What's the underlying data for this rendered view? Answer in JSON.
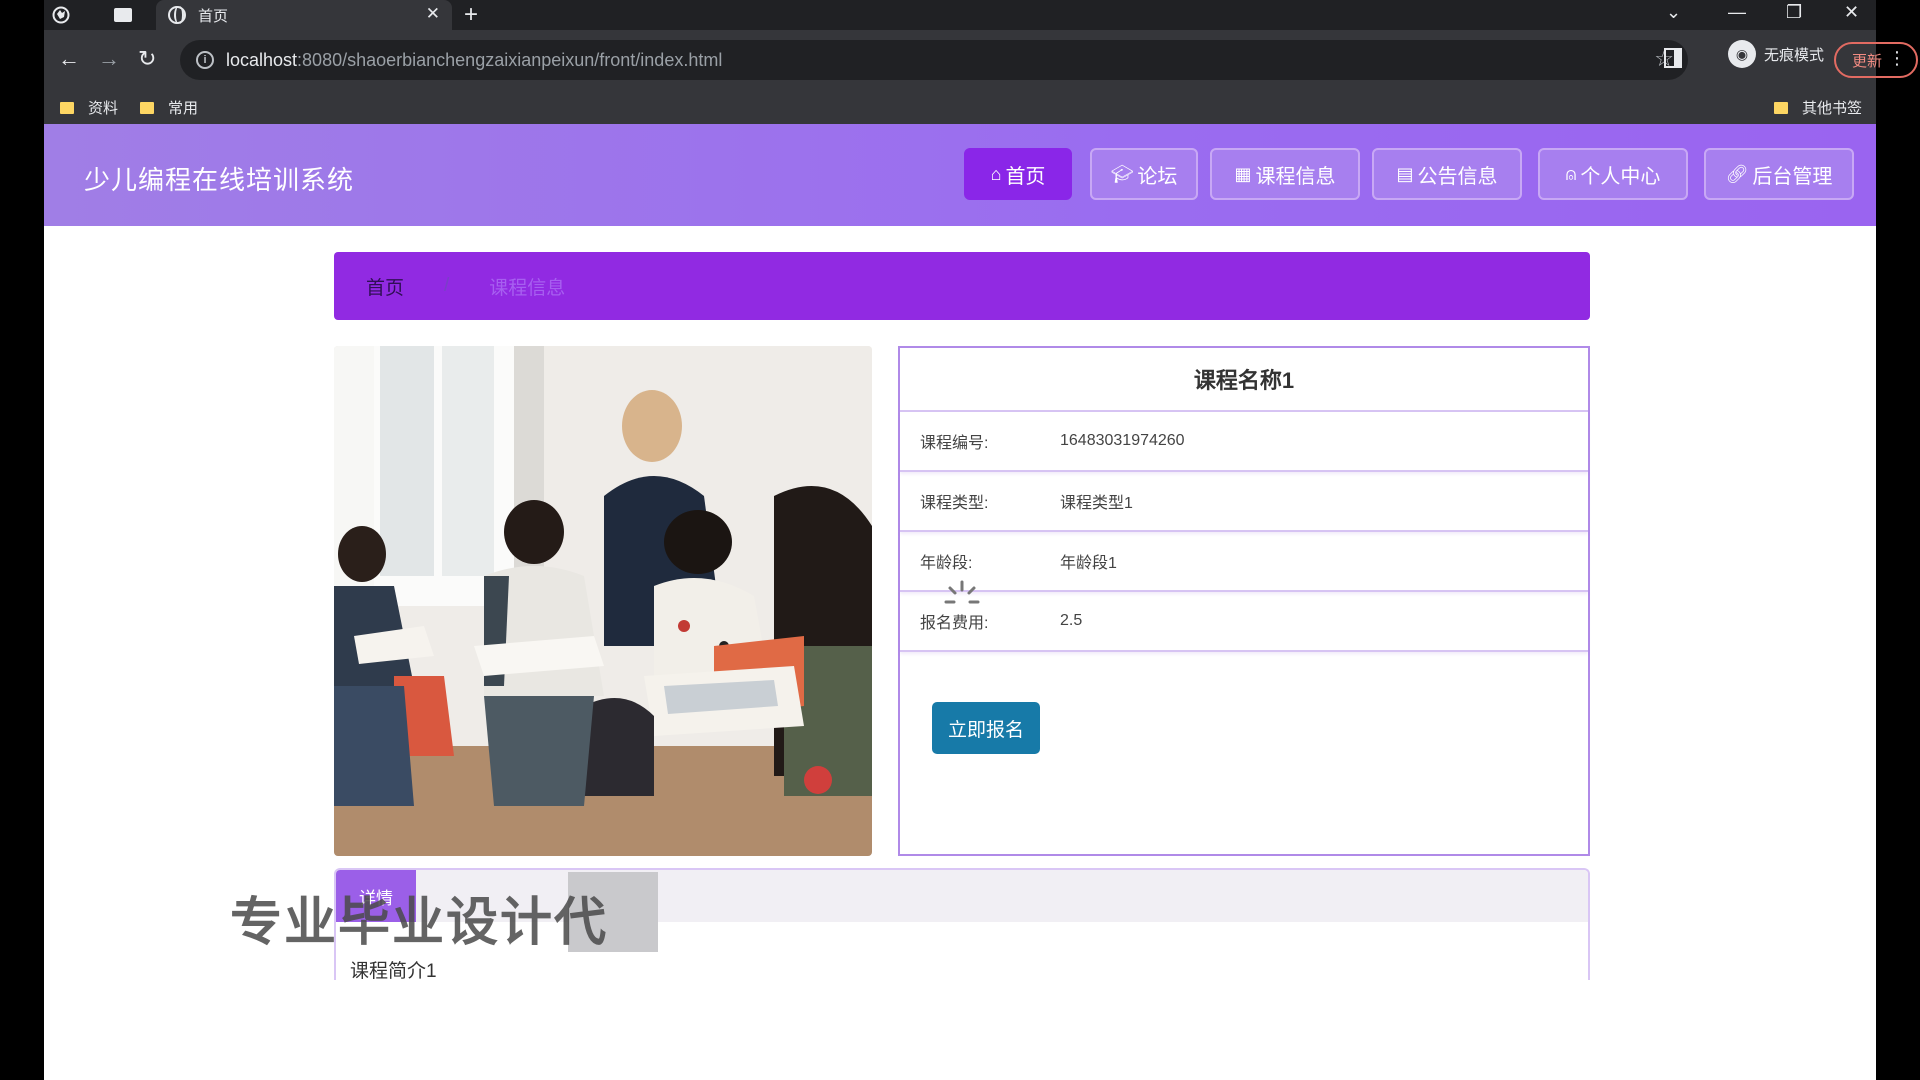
{
  "browser": {
    "tab_title": "首页",
    "url_host": "localhost",
    "url_path": ":8080/shaoerbianchengzaixianpeixun/front/index.html",
    "incognito_label": "无痕模式",
    "update_label": "更新",
    "bookmarks": [
      "资料",
      "常用"
    ],
    "other_bookmarks": "其他书签"
  },
  "site": {
    "title": "少儿编程在线培训系统",
    "nav": [
      {
        "label": "首页",
        "icon": "home-icon"
      },
      {
        "label": "论坛",
        "icon": "graduation-cap-icon"
      },
      {
        "label": "课程信息",
        "icon": "building-icon"
      },
      {
        "label": "公告信息",
        "icon": "clipboard-icon"
      },
      {
        "label": "个人中心",
        "icon": "user-icon"
      },
      {
        "label": "后台管理",
        "icon": "link-icon"
      }
    ]
  },
  "breadcrumb": {
    "home": "首页",
    "separator": "/",
    "current": "课程信息"
  },
  "course": {
    "name": "课程名称1",
    "fields": [
      {
        "label": "课程编号:",
        "value": "16483031974260"
      },
      {
        "label": "课程类型:",
        "value": "课程类型1"
      },
      {
        "label": "年龄段:",
        "value": "年龄段1"
      },
      {
        "label": "报名费用:",
        "value": "2.5"
      }
    ],
    "enroll_button": "立即报名",
    "intro_tab": "详情",
    "intro_text": "课程简介1"
  },
  "overlay": {
    "watermark": "专业毕业设计代"
  },
  "colors": {
    "header": "#9a6cf0",
    "nav_active": "#8a26e8",
    "breadcrumb": "#912ae2",
    "enroll": "#177aa8"
  }
}
